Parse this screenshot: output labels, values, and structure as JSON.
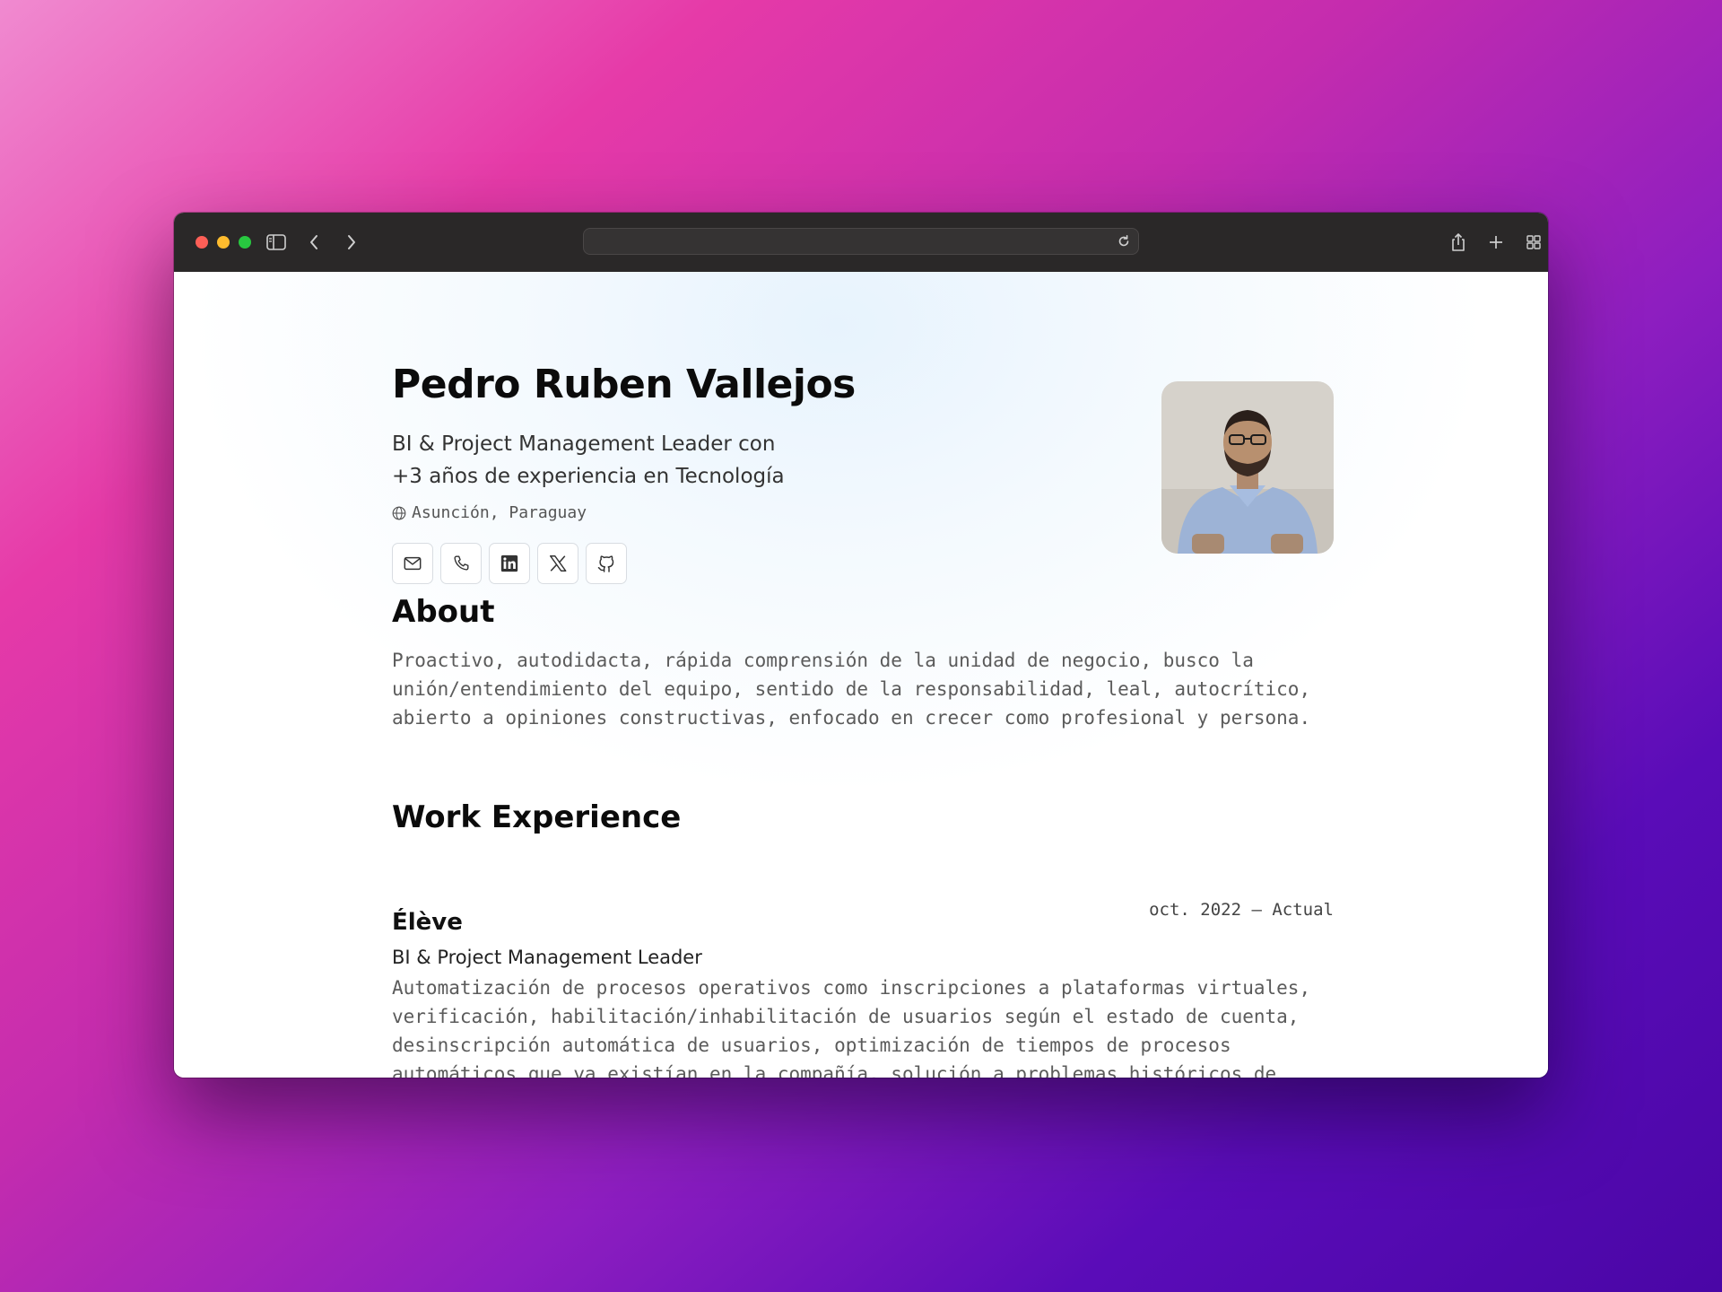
{
  "profile": {
    "name": "Pedro Ruben Vallejos",
    "subtitle": "BI & Project Management Leader con +3 años de experiencia en Tecnología",
    "location": "Asunción, Paraguay"
  },
  "socials": [
    {
      "icon": "mail-icon"
    },
    {
      "icon": "phone-icon"
    },
    {
      "icon": "linkedin-icon"
    },
    {
      "icon": "x-icon"
    },
    {
      "icon": "github-icon"
    }
  ],
  "about": {
    "title": "About",
    "text": "Proactivo, autodidacta, rápida comprensión de la unidad de negocio, busco la unión/entendimiento del equipo, sentido de la responsabilidad, leal, autocrítico, abierto a opiniones constructivas, enfocado en crecer como profesional y persona."
  },
  "work": {
    "title": "Work Experience",
    "items": [
      {
        "company": "Élève",
        "role": "BI & Project Management Leader",
        "period": "oct. 2022 – Actual",
        "description": "Automatización de procesos operativos como inscripciones a plataformas virtuales, verificación, habilitación/inhabilitación de usuarios según el estado de cuenta, desinscripción automática de usuarios, optimización de tiempos de procesos automáticos que ya existían en la compañía, solución a problemas históricos de"
      }
    ]
  },
  "colors": {
    "toolbar": "#2a2828",
    "close": "#fe5f57",
    "minimize": "#febc2e",
    "zoom": "#28c840"
  }
}
